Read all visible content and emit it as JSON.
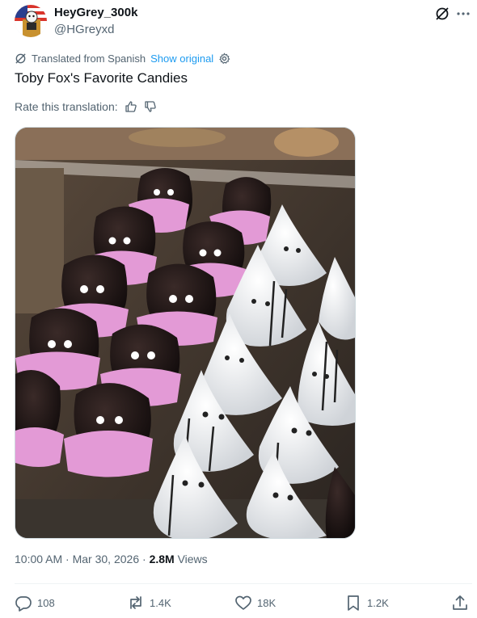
{
  "post": {
    "display_name": "HeyGrey_300k",
    "handle": "@HGreyxd",
    "translated_from": "Translated from Spanish",
    "show_original": "Show original",
    "text": "Toby Fox's Favorite Candies",
    "rate_translation": "Rate this translation:",
    "time": "10:00 AM",
    "sep": "·",
    "date": "Mar 30, 2026",
    "views_count": "2.8M",
    "views_label": "Views"
  },
  "actions": {
    "replies": "108",
    "reposts": "1.4K",
    "likes": "18K",
    "bookmarks": "1.2K"
  },
  "icons": [
    "grok-icon",
    "more-icon",
    "translate-icon",
    "gear-icon",
    "thumbs-up-icon",
    "thumbs-down-icon",
    "reply-icon",
    "repost-icon",
    "like-icon",
    "bookmark-icon",
    "share-icon"
  ],
  "colors": {
    "link": "#1d9bf0",
    "secondary": "#536471",
    "text": "#0f1419"
  }
}
